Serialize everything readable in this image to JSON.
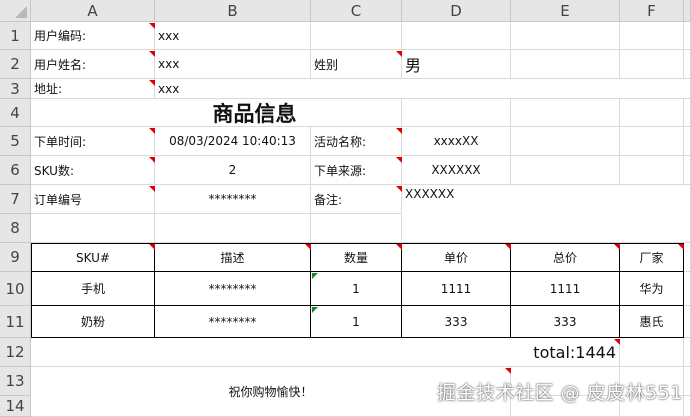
{
  "columns": [
    "A",
    "B",
    "C",
    "D",
    "E",
    "F"
  ],
  "rows": [
    "1",
    "2",
    "3",
    "4",
    "5",
    "6",
    "7",
    "8",
    "9",
    "10",
    "11",
    "12",
    "13",
    "14"
  ],
  "info": {
    "user_code_label": "用户编码:",
    "user_code": "xxx",
    "user_name_label": "用户姓名:",
    "user_name": "xxx",
    "gender_label": "姓别",
    "gender": "男",
    "address_label": "地址:",
    "address": "xxx",
    "section_title": "商品信息",
    "order_time_label": "下单时间:",
    "order_time": "08/03/2024 10:40:13",
    "activity_label": "活动名称:",
    "activity": "xxxxXX",
    "sku_count_label": "SKU数:",
    "sku_count": "2",
    "source_label": "下单来源:",
    "source": "XXXXXX",
    "order_no_label": "订单编号",
    "order_no": "********",
    "remark_label": "备注:",
    "remark": "XXXXXX"
  },
  "table": {
    "headers": [
      "SKU#",
      "描述",
      "数量",
      "单价",
      "总价",
      "厂家"
    ],
    "rows": [
      [
        "手机",
        "********",
        "1",
        "1111",
        "1111",
        "华为"
      ],
      [
        "奶粉",
        "********",
        "1",
        "333",
        "333",
        "惠氏"
      ]
    ]
  },
  "total": "total:1444",
  "greeting": "祝你购物愉快！",
  "watermark": "掘金技术社区 @ 皮皮林551",
  "colors": {
    "comment_marker": "#e00000",
    "error_marker": "#1a8a1a"
  }
}
